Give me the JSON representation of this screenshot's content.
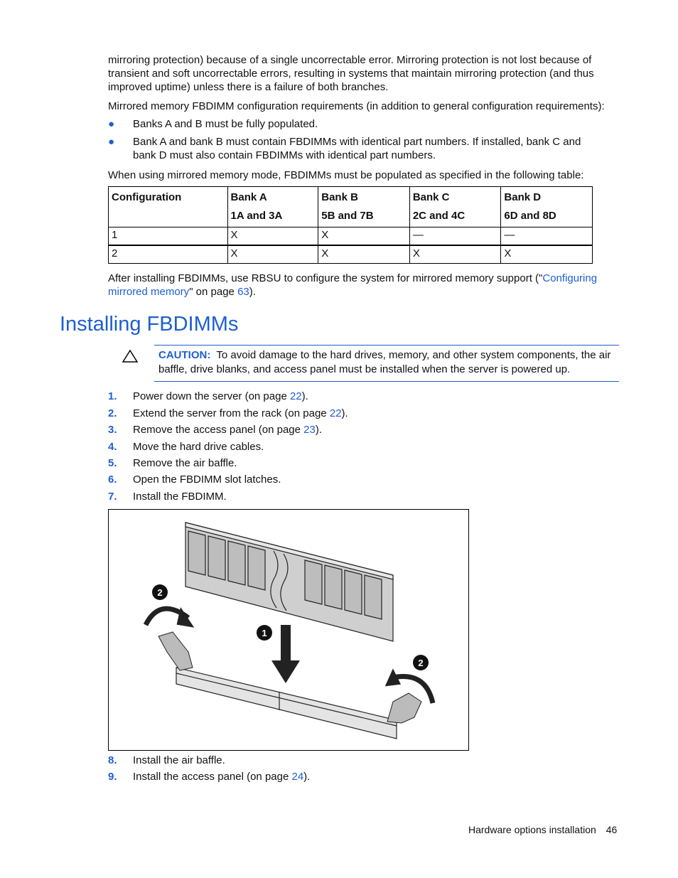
{
  "intro_paragraph": "mirroring protection) because of a single uncorrectable error. Mirroring protection is not lost because of transient and soft uncorrectable errors, resulting in systems that maintain mirroring protection (and thus improved uptime) unless there is a failure of both branches.",
  "requirements_intro": "Mirrored memory FBDIMM configuration requirements (in addition to general configuration requirements):",
  "bullets": [
    "Banks A and B must be fully populated.",
    "Bank A and bank B must contain FBDIMMs with identical part numbers. If installed, bank C and bank D must also contain FBDIMMs with identical part numbers."
  ],
  "table_intro": "When using mirrored memory mode, FBDIMMs must be populated as specified in the following table:",
  "table": {
    "headers": [
      [
        "Configuration",
        ""
      ],
      [
        "Bank A",
        "1A and 3A"
      ],
      [
        "Bank B",
        "5B and 7B"
      ],
      [
        "Bank C",
        "2C and 4C"
      ],
      [
        "Bank D",
        "6D and 8D"
      ]
    ],
    "rows": [
      [
        "1",
        "X",
        "X",
        "—",
        "—"
      ],
      [
        "2",
        "X",
        "X",
        "X",
        "X"
      ]
    ]
  },
  "after": {
    "text1": "After installing FBDIMMs, use RBSU to configure the system for mirrored memory support (\"",
    "link": "Configuring mirrored memory",
    "text2": "\" on page ",
    "page": "63",
    "text3": ")."
  },
  "heading": "Installing FBDIMMs",
  "caution": {
    "label": "CAUTION:",
    "text": "To avoid damage to the hard drives, memory, and other system components, the air baffle, drive blanks, and access panel must be installed when the server is powered up."
  },
  "steps": [
    {
      "n": "1.",
      "text": "Power down the server (on page ",
      "page": "22",
      "end": ")."
    },
    {
      "n": "2.",
      "text": "Extend the server from the rack (on page ",
      "page": "22",
      "end": ")."
    },
    {
      "n": "3.",
      "text": "Remove the access panel (on page ",
      "page": "23",
      "end": ")."
    },
    {
      "n": "4.",
      "text": "Move the hard drive cables."
    },
    {
      "n": "5.",
      "text": "Remove the air baffle."
    },
    {
      "n": "6.",
      "text": "Open the FBDIMM slot latches."
    },
    {
      "n": "7.",
      "text": "Install the FBDIMM."
    },
    {
      "n": "8.",
      "text": "Install the air baffle."
    },
    {
      "n": "9.",
      "text": "Install the access panel (on page ",
      "page": "24",
      "end": ")."
    }
  ],
  "figure": {
    "callouts": [
      "1",
      "2",
      "2"
    ]
  },
  "footer": {
    "section": "Hardware options installation",
    "page_number": "46"
  },
  "colors": {
    "accent": "#1d5fd0"
  }
}
